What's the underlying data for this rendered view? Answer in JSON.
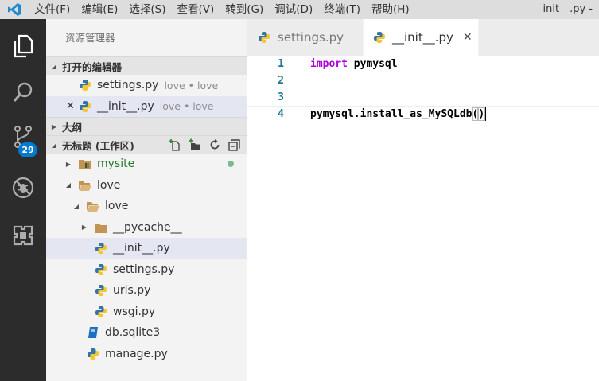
{
  "menu": [
    "文件(F)",
    "编辑(E)",
    "选择(S)",
    "查看(V)",
    "转到(G)",
    "调试(D)",
    "终端(T)",
    "帮助(H)"
  ],
  "window_title": "__init__.py - ",
  "activity_badge": "29",
  "sidebar": {
    "title": "资源管理器",
    "open_editors": {
      "header": "打开的编辑器",
      "items": [
        {
          "name": "settings.py",
          "desc": "love • love"
        },
        {
          "name": "__init__.py",
          "desc": "love • love"
        }
      ]
    },
    "outline": {
      "header": "大纲"
    },
    "workspace": {
      "header": "无标题 (工作区)",
      "tree": [
        {
          "label": "mysite"
        },
        {
          "label": "love"
        },
        {
          "label": "love"
        },
        {
          "label": "__pycache__"
        },
        {
          "label": "__init__.py"
        },
        {
          "label": "settings.py"
        },
        {
          "label": "urls.py"
        },
        {
          "label": "wsgi.py"
        },
        {
          "label": "db.sqlite3"
        },
        {
          "label": "manage.py"
        }
      ]
    }
  },
  "tabs": [
    {
      "label": "settings.py"
    },
    {
      "label": "__init__.py"
    }
  ],
  "editor": {
    "line_numbers": [
      "1",
      "2",
      "3",
      "4"
    ],
    "line1_keyword": "import",
    "line1_rest": " pymysql",
    "line4_code": "pymysql.install_as_MySQLdb",
    "line4_open": "(",
    "line4_close": ")"
  },
  "colors": {
    "accent": "#007acc",
    "git_added": "#237d2b",
    "keyword": "#af00db",
    "line_number": "#237893"
  }
}
